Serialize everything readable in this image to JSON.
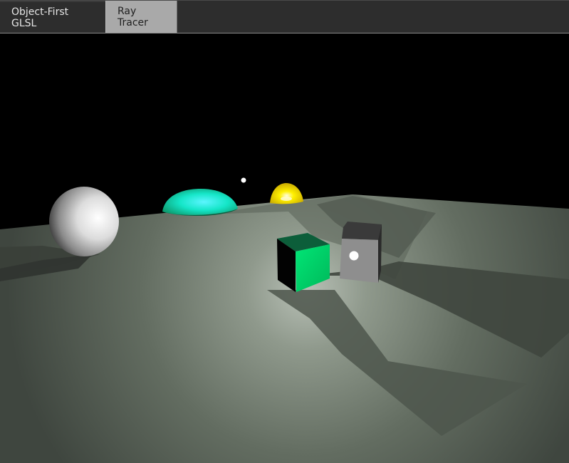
{
  "window": {
    "tabs": [
      {
        "label": "Object-First GLSL",
        "active": false
      },
      {
        "label": "Ray Tracer",
        "active": true
      }
    ]
  },
  "scene": {
    "background_color": "#000000",
    "floor_color": "#6b7468",
    "objects": [
      {
        "name": "white-sphere",
        "color": "#d9d9d9"
      },
      {
        "name": "cyan-dome",
        "color": "#19e6c8"
      },
      {
        "name": "yellow-dome",
        "color": "#ffe600"
      },
      {
        "name": "green-cube",
        "color": "#00d36b"
      },
      {
        "name": "gray-cube",
        "color": "#8d8d8d"
      },
      {
        "name": "light-point",
        "color": "#ffffff"
      }
    ]
  }
}
